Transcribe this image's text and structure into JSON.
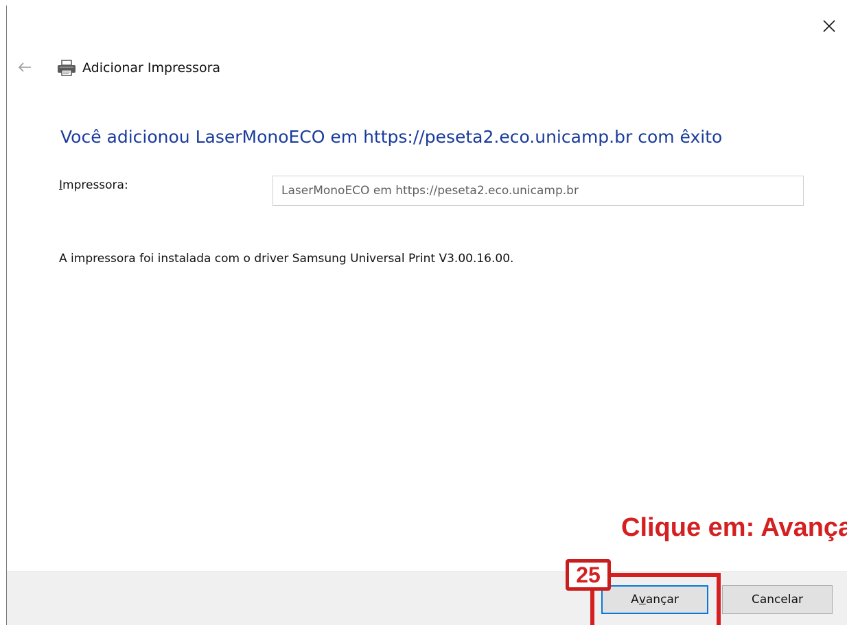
{
  "window": {
    "title": "Adicionar Impressora",
    "close_symbol": "✕",
    "back_symbol": "←",
    "title_icon": "printer-icon"
  },
  "main": {
    "heading": "Você adicionou LaserMonoECO em https://peseta2.eco.unicamp.br com êxito",
    "printer_label_accel": "I",
    "printer_label_rest": "mpressora:",
    "printer_value": "LaserMonoECO em https://peseta2.eco.unicamp.br",
    "driver_message": "A impressora foi instalada com o driver Samsung Universal Print V3.00.16.00."
  },
  "footer": {
    "next_button": {
      "before": "A",
      "accel": "v",
      "after": "ançar"
    },
    "cancel_button": "Cancelar"
  },
  "annotation": {
    "step_number": "25",
    "instruction": "Clique em: Avançar",
    "color": "#d42020"
  },
  "colors": {
    "heading": "#1a3c9c",
    "focus_border": "#0a78d7",
    "footer_bg": "#f0f0f0"
  }
}
